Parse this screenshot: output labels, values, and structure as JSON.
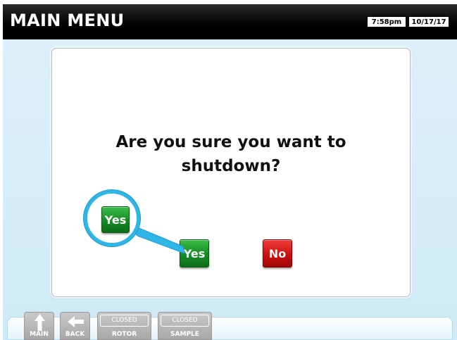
{
  "header": {
    "title": "MAIN MENU",
    "time": "7:58pm",
    "date": "10/17/17"
  },
  "dialog": {
    "question_line1": "Are you sure you want to",
    "question_line2": "shutdown?",
    "yes_label": "Yes",
    "no_label": "No"
  },
  "callout": {
    "yes_label": "Yes"
  },
  "bottom_nav": {
    "main_label": "MAIN",
    "back_label": "BACK",
    "rotor_status": "CLOSED",
    "rotor_label": "ROTOR",
    "sample_status": "CLOSED",
    "sample_label": "SAMPLE"
  },
  "colors": {
    "title_bar": "#000000",
    "background": "#dff1fb",
    "yes_button": "#158a25",
    "no_button": "#cc1010",
    "callout_ring": "#2fb6e6",
    "nav_button": "#b5b5b5"
  },
  "icons": {
    "main": "up-arrow-icon",
    "back": "left-arrow-icon"
  }
}
